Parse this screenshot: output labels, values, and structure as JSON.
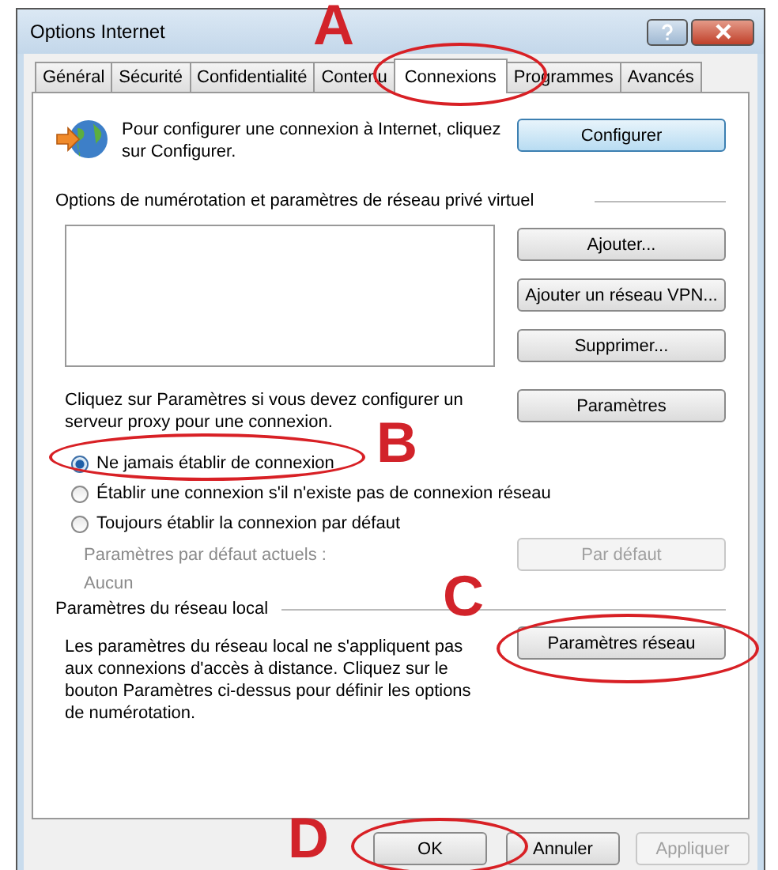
{
  "window": {
    "title": "Options Internet"
  },
  "tabs": [
    {
      "label": "Général",
      "selected": false
    },
    {
      "label": "Sécurité",
      "selected": false
    },
    {
      "label": "Confidentialité",
      "selected": false
    },
    {
      "label": "Contenu",
      "selected": false
    },
    {
      "label": "Connexions",
      "selected": true
    },
    {
      "label": "Programmes",
      "selected": false
    },
    {
      "label": "Avancés",
      "selected": false
    }
  ],
  "setup": {
    "text": "Pour configurer une connexion à Internet, cliquez sur Configurer.",
    "button": "Configurer"
  },
  "dialup": {
    "heading": "Options de numérotation et paramètres de réseau privé virtuel",
    "buttons": [
      {
        "label": "Ajouter...",
        "disabled": false
      },
      {
        "label": "Ajouter un réseau VPN...",
        "disabled": false
      },
      {
        "label": "Supprimer...",
        "disabled": false
      }
    ],
    "proxy_text": "Cliquez sur Paramètres si vous devez configurer un serveur proxy pour une connexion.",
    "proxy_button": {
      "label": "Paramètres",
      "disabled": false
    },
    "options": [
      {
        "label": "Ne jamais établir de connexion",
        "selected": true
      },
      {
        "label": "Établir une connexion s'il n'existe pas de connexion réseau",
        "selected": false
      },
      {
        "label": "Toujours établir la connexion par défaut",
        "selected": false
      }
    ],
    "default_label": "Paramètres par défaut actuels :",
    "default_value": "Aucun",
    "default_button": {
      "label": "Par défaut",
      "disabled": true
    }
  },
  "lan": {
    "heading": "Paramètres du réseau local",
    "text": "Les paramètres du réseau local ne s'appliquent pas aux connexions d'accès à distance. Cliquez sur le bouton Paramètres ci-dessus pour définir les options de numérotation.",
    "button": {
      "label": "Paramètres réseau",
      "disabled": false
    }
  },
  "footer_buttons": [
    {
      "label": "OK",
      "disabled": false
    },
    {
      "label": "Annuler",
      "disabled": false
    },
    {
      "label": "Appliquer",
      "disabled": true
    }
  ],
  "annotations": [
    {
      "letter": "A"
    },
    {
      "letter": "B"
    },
    {
      "letter": "C"
    },
    {
      "letter": "D"
    }
  ]
}
